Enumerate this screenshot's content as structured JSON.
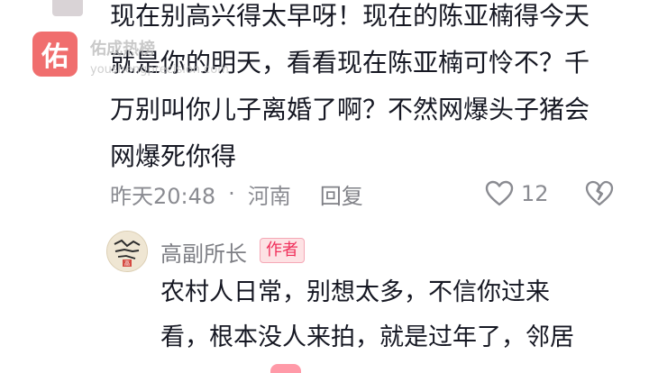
{
  "comment": {
    "text": "现在别高兴得太早呀！现在的陈亚楠得今天\n就是你的明天，看看现在陈亚楠可怜不？千\n万别叫你儿子离婚了啊？不然网爆头子猪会\n网爆死你得",
    "time": "昨天20:48",
    "separator": "·",
    "location": "河南",
    "reply_label": "回复",
    "like_count": "12",
    "icons": [
      "heart-outline-icon",
      "broken-heart-icon"
    ]
  },
  "reply": {
    "author": "高副所长",
    "author_badge": "作者",
    "avatar_seal_text": "高",
    "text": "农村人日常，别想太多，不信你过来\n看，根本没人来拍，就是过年了，邻居"
  },
  "watermark": {
    "badge": "佑",
    "title": "佑成热榜",
    "url": "youshengprecision.com"
  },
  "colors": {
    "badge_bg": "#fde2e4",
    "badge_text": "#f0305b",
    "meta_text": "#8a8b91",
    "watermark_red": "#ef6262"
  }
}
